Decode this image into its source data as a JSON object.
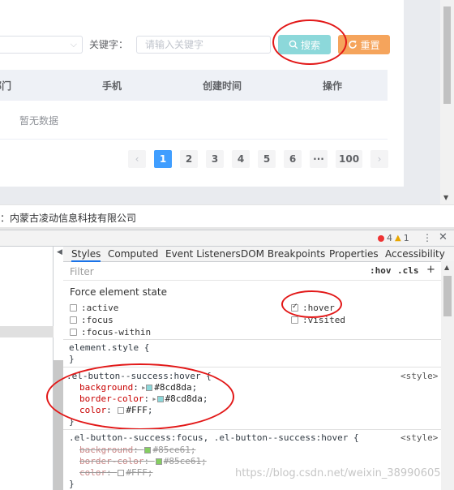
{
  "search": {
    "keyword_label": "关键字：",
    "keyword_placeholder": "请输入关键字",
    "search_label": "搜索",
    "reset_label": "重置"
  },
  "table": {
    "headers": [
      "部门",
      "手机",
      "创建时间",
      "操作"
    ],
    "empty_text": "暂无数据"
  },
  "pagination": {
    "prev": "‹",
    "pages": [
      "1",
      "2",
      "3",
      "4",
      "5",
      "6",
      "···",
      "100"
    ],
    "active_page": "1",
    "next": "›"
  },
  "company": "：内蒙古凌动信息科技有限公司",
  "devtools": {
    "error_count": "4",
    "warning_count": "1",
    "menu": "⋮",
    "close": "✕",
    "tabs": [
      "Styles",
      "Computed",
      "Event Listeners",
      "DOM Breakpoints",
      "Properties",
      "Accessibility"
    ],
    "filter_placeholder": "Filter",
    "hov": ":hov",
    "cls": ".cls",
    "add": "+",
    "force_state_title": "Force element state",
    "states": [
      {
        "label": ":active",
        "checked": false
      },
      {
        "label": ":focus",
        "checked": false
      },
      {
        "label": ":focus-within",
        "checked": false
      },
      {
        "label": ":hover",
        "checked": true
      },
      {
        "label": ":visited",
        "checked": false
      }
    ],
    "rules": {
      "element_style": "element.style {",
      "close_brace": "}",
      "hover_selector": ".el-button--success:hover {",
      "hover_source": "<style>",
      "hover_props": [
        {
          "name": "background",
          "value": "#8cd8da",
          "color": "#8cd8da"
        },
        {
          "name": "border-color",
          "value": "#8cd8da",
          "color": "#8cd8da"
        },
        {
          "name": "color",
          "value": "#FFF",
          "color": "#ffffff"
        }
      ],
      "focus_selector": ".el-button--success:focus, .el-button--success:hover {",
      "focus_source": "<style>",
      "focus_props": [
        {
          "name": "background",
          "value": "#85ce61",
          "color": "#85ce61"
        },
        {
          "name": "border-color",
          "value": "#85ce61",
          "color": "#85ce61"
        },
        {
          "name": "color",
          "value": "#FFF",
          "color": "#ffffff"
        }
      ]
    }
  },
  "watermark": "https://blog.csdn.net/weixin_38990605",
  "colors": {
    "search_button": "#8cd8da",
    "reset_button": "#f5a45c",
    "active_page": "#409eff",
    "annotation": "#e21818"
  }
}
